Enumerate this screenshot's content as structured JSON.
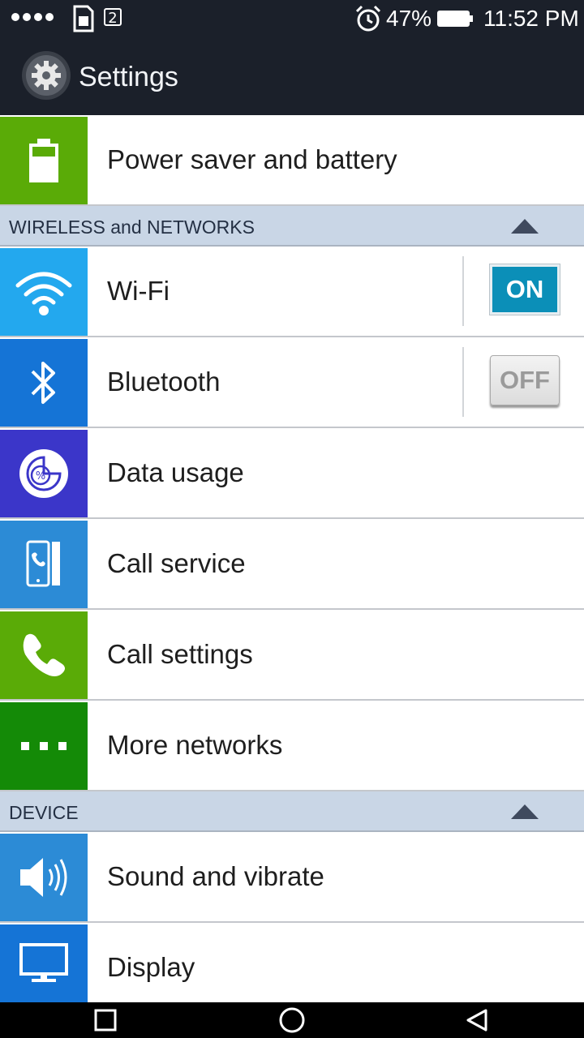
{
  "status_bar": {
    "sim_badge": "2",
    "battery_percent": "47%",
    "time": "11:52 PM"
  },
  "header": {
    "title": "Settings",
    "icon": "gear-icon"
  },
  "rows": {
    "power": {
      "label": "Power saver and battery",
      "icon": "battery-icon",
      "color": "#5aab07"
    },
    "wifi": {
      "label": "Wi-Fi",
      "icon": "wifi-icon",
      "color": "#23a8ee",
      "toggle": "ON"
    },
    "bluetooth": {
      "label": "Bluetooth",
      "icon": "bluetooth-icon",
      "color": "#1574d6",
      "toggle": "OFF"
    },
    "data_usage": {
      "label": "Data usage",
      "icon": "data-usage-icon",
      "color": "#3b36c9"
    },
    "call_service": {
      "label": "Call service",
      "icon": "call-service-icon",
      "color": "#2c8bd6"
    },
    "call_settings": {
      "label": "Call settings",
      "icon": "phone-icon",
      "color": "#5aab07"
    },
    "more_networks": {
      "label": "More networks",
      "icon": "more-icon",
      "color": "#148a07"
    },
    "sound": {
      "label": "Sound and vibrate",
      "icon": "speaker-icon",
      "color": "#2c8bd6"
    },
    "display": {
      "label": "Display",
      "icon": "monitor-icon",
      "color": "#1574d6"
    }
  },
  "sections": {
    "wireless": "WIRELESS and NETWORKS",
    "device": "DEVICE"
  },
  "nav": [
    "recents-icon",
    "home-icon",
    "back-icon"
  ]
}
